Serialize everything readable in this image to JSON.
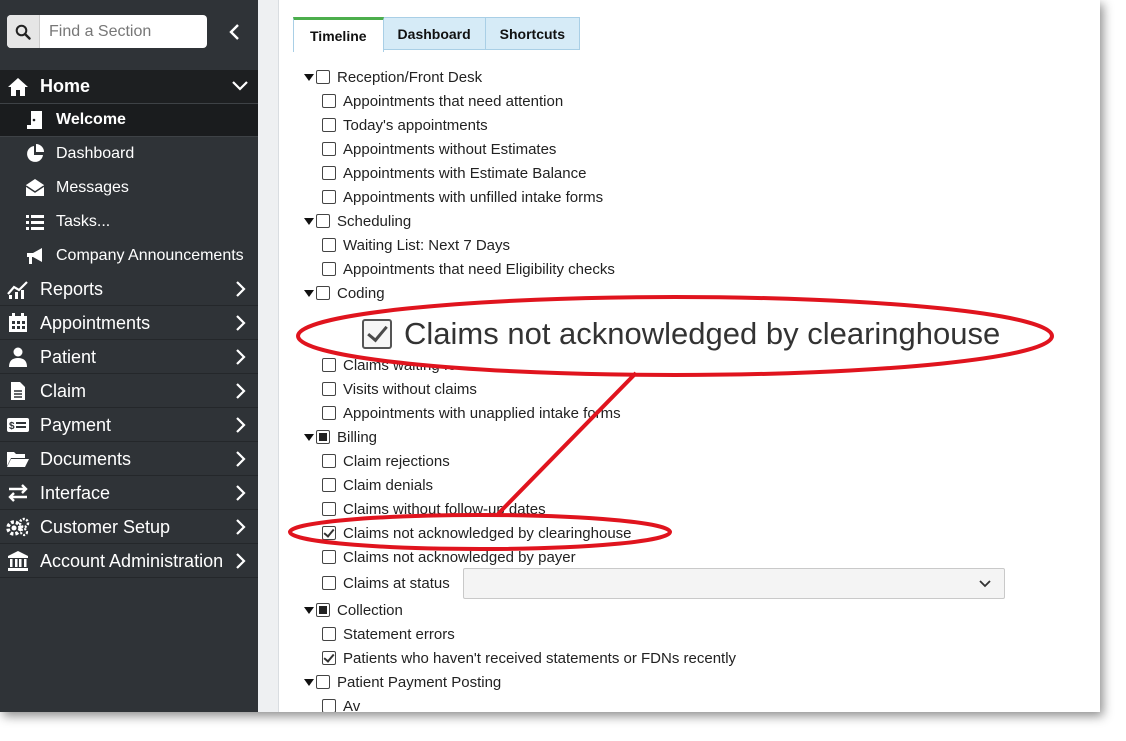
{
  "search": {
    "placeholder": "Find a Section"
  },
  "sidebar": {
    "home": {
      "label": "Home",
      "icon": "home-icon"
    },
    "sub_items": [
      {
        "label": "Welcome",
        "icon": "door-icon",
        "active": true
      },
      {
        "label": "Dashboard",
        "icon": "pie-chart-icon"
      },
      {
        "label": "Messages",
        "icon": "envelope-icon"
      },
      {
        "label": "Tasks...",
        "icon": "list-icon"
      },
      {
        "label": "Company Announcements",
        "icon": "megaphone-icon"
      }
    ],
    "items": [
      {
        "label": "Reports",
        "icon": "chart-icon"
      },
      {
        "label": "Appointments",
        "icon": "calendar-icon"
      },
      {
        "label": "Patient",
        "icon": "person-icon"
      },
      {
        "label": "Claim",
        "icon": "document-icon"
      },
      {
        "label": "Payment",
        "icon": "money-icon"
      },
      {
        "label": "Documents",
        "icon": "folder-icon"
      },
      {
        "label": "Interface",
        "icon": "arrows-icon"
      },
      {
        "label": "Customer Setup",
        "icon": "gears-icon"
      },
      {
        "label": "Account Administration",
        "icon": "bank-icon"
      }
    ]
  },
  "tabs": [
    {
      "label": "Timeline",
      "active": true
    },
    {
      "label": "Dashboard"
    },
    {
      "label": "Shortcuts"
    }
  ],
  "tree": {
    "reception": {
      "label": "Reception/Front Desk",
      "state": "unchecked"
    },
    "reception_items": [
      {
        "label": "Appointments that need attention",
        "state": "unchecked"
      },
      {
        "label": "Today's appointments",
        "state": "unchecked"
      },
      {
        "label": "Appointments without Estimates",
        "state": "unchecked"
      },
      {
        "label": "Appointments with Estimate Balance",
        "state": "unchecked"
      },
      {
        "label": "Appointments with unfilled intake forms",
        "state": "unchecked"
      }
    ],
    "scheduling": {
      "label": "Scheduling",
      "state": "unchecked"
    },
    "scheduling_items": [
      {
        "label": "Waiting List: Next 7 Days",
        "state": "unchecked"
      },
      {
        "label": "Appointments that need Eligibility checks",
        "state": "unchecked"
      }
    ],
    "coding": {
      "label": "Coding",
      "state": "unchecked"
    },
    "coding_items": [
      {
        "label": "Claims waiting fo",
        "state": "unchecked"
      },
      {
        "label": "Visits without claims",
        "state": "unchecked"
      },
      {
        "label": "Appointments with unapplied intake forms",
        "state": "unchecked"
      }
    ],
    "billing": {
      "label": "Billing",
      "state": "partial"
    },
    "billing_items": [
      {
        "label": "Claim rejections",
        "state": "unchecked"
      },
      {
        "label": "Claim denials",
        "state": "unchecked"
      },
      {
        "label": "Claims without follow-up dates",
        "state": "unchecked"
      },
      {
        "label": "Claims not acknowledged by clearinghouse",
        "state": "checked"
      },
      {
        "label": "Claims not acknowledged by payer",
        "state": "unchecked"
      },
      {
        "label": "Claims at status",
        "state": "unchecked"
      }
    ],
    "collection": {
      "label": "Collection",
      "state": "partial"
    },
    "collection_items": [
      {
        "label": "Statement errors",
        "state": "unchecked"
      },
      {
        "label": "Patients who haven't received statements or FDNs recently",
        "state": "checked"
      }
    ],
    "payment_posting": {
      "label": "Patient Payment Posting",
      "state": "unchecked"
    },
    "payment_posting_items": [
      {
        "label": "Av",
        "state": "unchecked"
      }
    ]
  },
  "status_select": {
    "value": ""
  },
  "callout": {
    "label": "Claims not acknowledged by clearinghouse"
  },
  "annotation": {
    "color": "#e0141e"
  }
}
